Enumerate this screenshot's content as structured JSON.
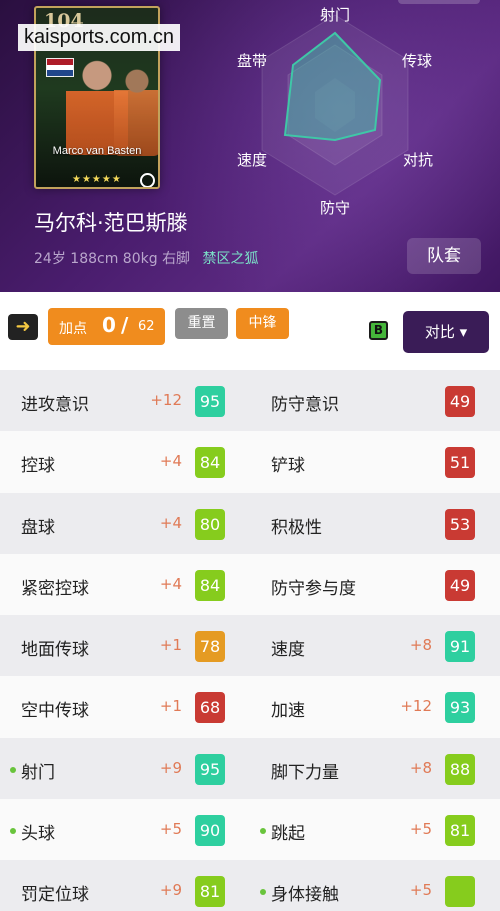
{
  "watermark": "kaisports.com.cn",
  "card": {
    "rating": "104",
    "name_on_card": "Marco van Basten",
    "stars": "★★★★★",
    "flag_colors": [
      "#ae1c28",
      "#ffffff",
      "#21468b"
    ]
  },
  "player": {
    "name": "马尔科·范巴斯滕",
    "age": "24岁",
    "height": "188cm",
    "weight": "80kg",
    "foot": "右脚",
    "alias": "禁区之狐",
    "kit_button": "队套"
  },
  "radar": {
    "labels": [
      "射门",
      "传球",
      "对抗",
      "防守",
      "速度",
      "盘带"
    ],
    "shape_color": "#3fc7a7"
  },
  "controls": {
    "points_label": "加点",
    "points_current": "0",
    "points_separator": "/",
    "points_max": "62",
    "reset_label": "重置",
    "position_label": "中锋",
    "grade": "B",
    "compare_label": "对比 ▾"
  },
  "stats": [
    {
      "left": {
        "name": "进攻意识",
        "bonus": "+12",
        "value": "95",
        "color": "#2ecf9f",
        "dot": false
      },
      "right": {
        "name": "防守意识",
        "bonus": "",
        "value": "49",
        "color": "#c93a33",
        "dot": false
      }
    },
    {
      "left": {
        "name": "控球",
        "bonus": "+4",
        "value": "84",
        "color": "#86cc1d",
        "dot": false
      },
      "right": {
        "name": "铲球",
        "bonus": "",
        "value": "51",
        "color": "#c93a33",
        "dot": false
      }
    },
    {
      "left": {
        "name": "盘球",
        "bonus": "+4",
        "value": "80",
        "color": "#86cc1d",
        "dot": false
      },
      "right": {
        "name": "积极性",
        "bonus": "",
        "value": "53",
        "color": "#c93a33",
        "dot": false
      }
    },
    {
      "left": {
        "name": "紧密控球",
        "bonus": "+4",
        "value": "84",
        "color": "#86cc1d",
        "dot": false
      },
      "right": {
        "name": "防守参与度",
        "bonus": "",
        "value": "49",
        "color": "#c93a33",
        "dot": false
      }
    },
    {
      "left": {
        "name": "地面传球",
        "bonus": "+1",
        "value": "78",
        "color": "#e59b23",
        "dot": false
      },
      "right": {
        "name": "速度",
        "bonus": "+8",
        "value": "91",
        "color": "#2ecf9f",
        "dot": false
      }
    },
    {
      "left": {
        "name": "空中传球",
        "bonus": "+1",
        "value": "68",
        "color": "#c93a33",
        "dot": false
      },
      "right": {
        "name": "加速",
        "bonus": "+12",
        "value": "93",
        "color": "#2ecf9f",
        "dot": false
      }
    },
    {
      "left": {
        "name": "射门",
        "bonus": "+9",
        "value": "95",
        "color": "#2ecf9f",
        "dot": true
      },
      "right": {
        "name": "脚下力量",
        "bonus": "+8",
        "value": "88",
        "color": "#86cc1d",
        "dot": false
      }
    },
    {
      "left": {
        "name": "头球",
        "bonus": "+5",
        "value": "90",
        "color": "#2ecf9f",
        "dot": true
      },
      "right": {
        "name": "跳起",
        "bonus": "+5",
        "value": "81",
        "color": "#86cc1d",
        "dot": true
      }
    },
    {
      "left": {
        "name": "罚定位球",
        "bonus": "+9",
        "value": "81",
        "color": "#86cc1d",
        "dot": false
      },
      "right": {
        "name": "身体接触",
        "bonus": "+5",
        "value": "",
        "color": "#86cc1d",
        "dot": true
      }
    }
  ]
}
